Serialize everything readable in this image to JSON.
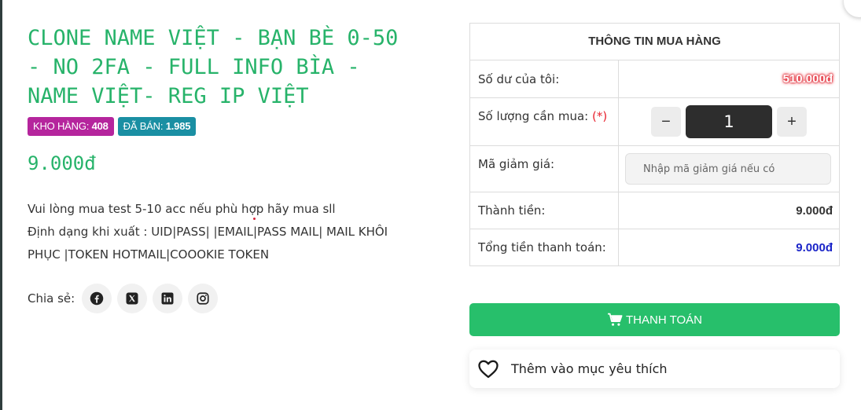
{
  "product": {
    "title": "CLONE NAME VIỆT - BẠN BÈ 0-50 - NO 2FA - FULL INFO BÌA - NAME VIỆT- REG IP VIỆT",
    "stock_label": "KHO HÀNG:",
    "stock_value": "408",
    "sold_label": "ĐÃ BÁN:",
    "sold_value": "1.985",
    "price": "9.000đ",
    "description_lines": [
      "Vui lòng mua test 5-10 acc nếu phù hợp hãy mua sll",
      "Định dạng khi xuất : UID|PASS| |EMAIL|PASS MAIL| MAIL KHÔI",
      "PHỤC |TOKEN HOTMAIL|COOOKIE TOKEN"
    ]
  },
  "share": {
    "label": "Chia sẻ:",
    "icons": [
      "facebook-icon",
      "x-icon",
      "linkedin-icon",
      "instagram-icon"
    ]
  },
  "purchase": {
    "header": "THÔNG TIN MUA HÀNG",
    "balance_label": "Số dư của tôi:",
    "balance_value": "510.000đ",
    "quantity_label": "Số lượng cần mua:",
    "quantity_required": "(*)",
    "quantity_value": "1",
    "minus": "−",
    "plus": "+",
    "coupon_label": "Mã giảm giá:",
    "coupon_placeholder": "Nhập mã giảm giá nếu có",
    "subtotal_label": "Thành tiền:",
    "subtotal_value": "9.000đ",
    "total_label": "Tổng tiền thanh toán:",
    "total_value": "9.000đ"
  },
  "actions": {
    "checkout_label": "THANH TOÁN",
    "wishlist_label": "Thêm vào mục yêu thích"
  },
  "colors": {
    "accent_green": "#27b36a",
    "stock_badge": "#b5259d",
    "sold_badge": "#1a8fa3",
    "checkout_button": "#27bf6b",
    "balance_glow": "#e8232f",
    "total_blue": "#1a24c8"
  }
}
